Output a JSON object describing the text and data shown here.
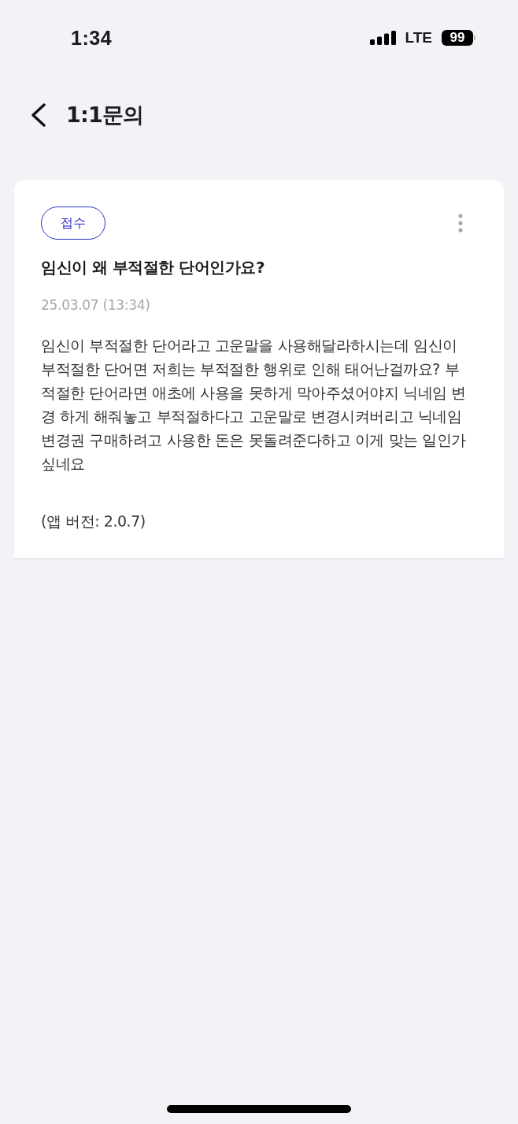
{
  "status_bar": {
    "time": "1:34",
    "network": "LTE",
    "battery": "99"
  },
  "header": {
    "title": "1:1문의"
  },
  "inquiry": {
    "status": "접수",
    "title": "임신이 왜 부적절한 단어인가요?",
    "date": "25.03.07 (13:34)",
    "body": "임신이 부적절한 단어라고 고운말을 사용해달라하시는데 임신이 부적절한 단어면 저희는 부적절한 행위로 인해 태어난걸까요? 부적절한 단어라면 애초에 사용을 못하게 막아주셨어야지 닉네임 변경 하게 해줘놓고 부적절하다고 고운말로 변경시켜버리고 닉네임 변경권 구매하려고 사용한 돈은 못돌려준다하고 이게 맞는 일인가 싶네요",
    "app_version": "(앱 버전: 2.0.7)"
  }
}
